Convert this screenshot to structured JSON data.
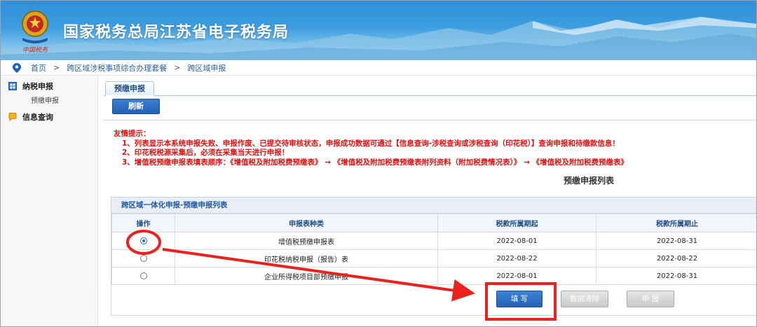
{
  "header": {
    "title": "国家税务总局江苏省电子税务局",
    "logo_icon": "tax-emblem-icon",
    "logo_caption": "中国税务"
  },
  "breadcrumb": {
    "items": [
      "首页",
      "跨区域涉税事项综合办理套餐",
      "跨区域申报"
    ],
    "separator": ">"
  },
  "sidebar": {
    "groups": [
      {
        "label": "纳税申报",
        "icon": "grid-icon",
        "items": [
          "预缴申报"
        ]
      },
      {
        "label": "信息查询",
        "icon": "chat-icon",
        "items": []
      }
    ]
  },
  "main": {
    "tab": "预缴申报",
    "refresh_label": "刷新",
    "notice": {
      "title": "友情提示：",
      "lines": [
        "1、列表显示本系统申报失败、申报作废、已提交待审核状态，申报成功数据可通过【信息查询-涉税查询或涉税查询（印花税）】查询申报和待缴款信息！",
        "2、印花税税源采集后，必须在采集当天进行申报！",
        "3、增值税预缴申报表填表顺序：《增值税及附加税费预缴表》 → 《增值税及附加税费预缴表附列资料（附加税费情况表）》 → 《增值税及附加税费预缴表》"
      ]
    },
    "list_title": "预缴申报列表",
    "panel_title": "跨区域一体化申报-预缴申报列表",
    "table": {
      "headers": [
        "操作",
        "申报表种类",
        "税款所属期起",
        "税款所属期止"
      ],
      "rows": [
        {
          "selected": true,
          "type": "增值税预缴申报表",
          "start": "2022-08-01",
          "end": "2022-08-31"
        },
        {
          "selected": false,
          "type": "印花税纳税申报（报告）表",
          "start": "2022-08-22",
          "end": "2022-08-22"
        },
        {
          "selected": false,
          "type": "企业所得税项目部预缴申报",
          "start": "2022-08-01",
          "end": "2022-08-31"
        }
      ]
    },
    "actions": {
      "fill": "填 写",
      "clear": "数据清除",
      "submit": "申 报"
    }
  },
  "colors": {
    "notice_red": "#e01010",
    "brand_blue": "#2462b4",
    "annotation_red": "#e8231f"
  }
}
